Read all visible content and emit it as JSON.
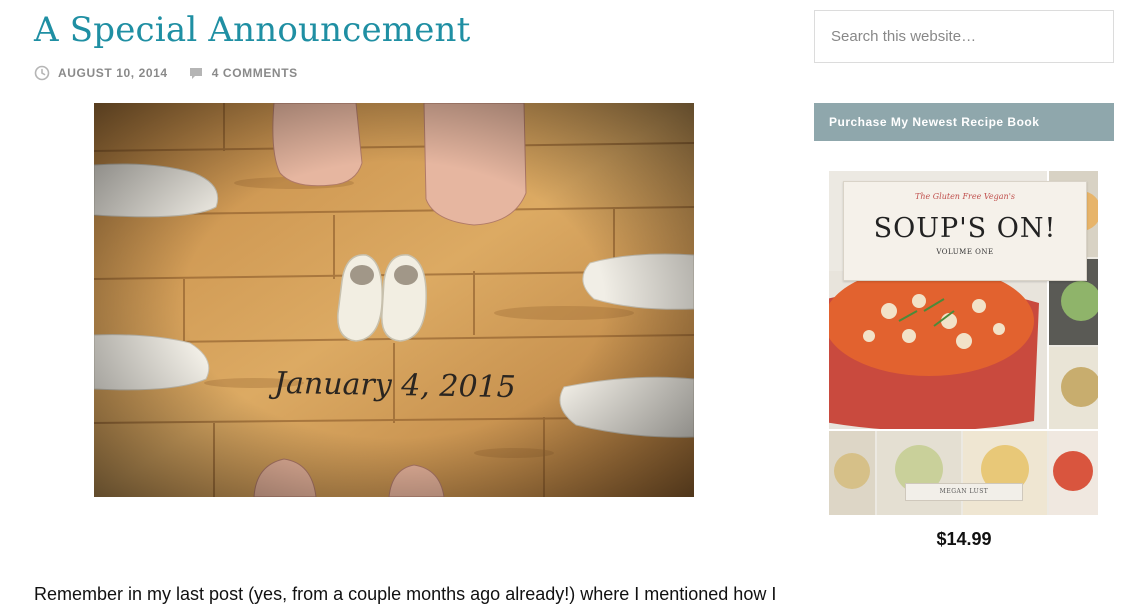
{
  "post": {
    "title": "A Special Announcement",
    "date": "AUGUST 10, 2014",
    "comments": "4 COMMENTS",
    "image_text": "January 4, 2015",
    "body_start": "Remember in my last post (yes, from a couple months ago already!) where I mentioned how I"
  },
  "sidebar": {
    "search_placeholder": "Search this website…",
    "widget_title": "Purchase My Newest Recipe Book",
    "book": {
      "subtitle": "The Gluten Free Vegan's",
      "title": "SOUP'S ON!",
      "volume": "VOLUME ONE",
      "author": "MEGAN LUST"
    },
    "price": "$14.99"
  },
  "icons": {
    "date": "clock-icon",
    "comments": "comment-bubble-icon"
  },
  "colors": {
    "title": "#1f8fa3",
    "widget_bg": "#8fa7ac",
    "meta": "#8a8a8a"
  }
}
